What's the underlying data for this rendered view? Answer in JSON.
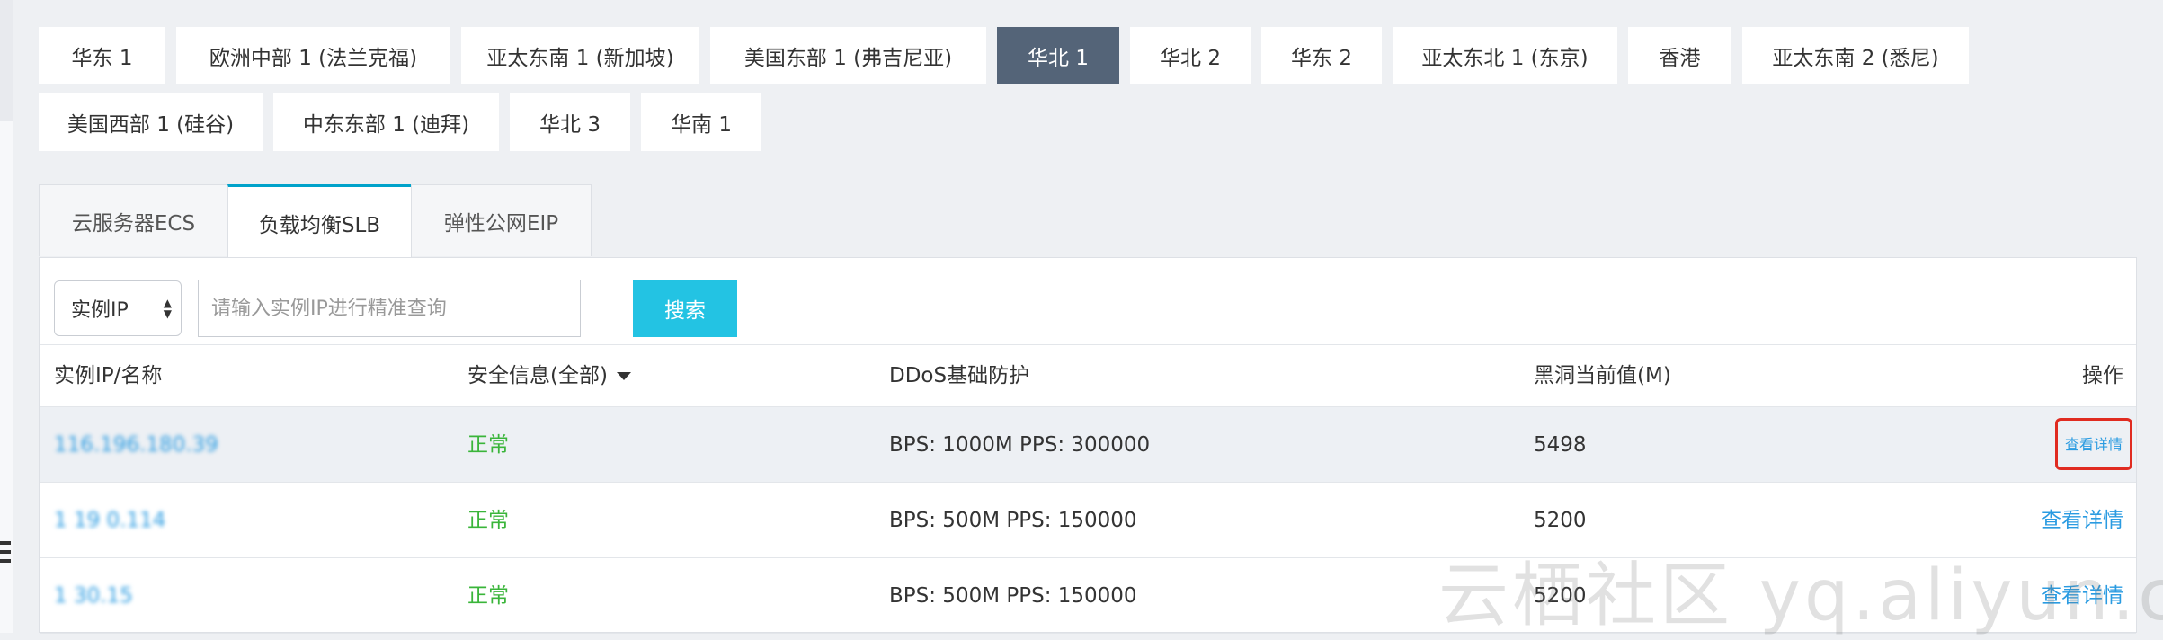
{
  "regions": {
    "row1": [
      "华东 1",
      "欧洲中部 1 (法兰克福)",
      "亚太东南 1 (新加坡)",
      "美国东部 1 (弗吉尼亚)",
      "华北 1",
      "华北 2",
      "华东 2",
      "亚太东北 1 (东京)",
      "香港",
      "亚太东南 2 (悉尼)"
    ],
    "row2": [
      "美国西部 1 (硅谷)",
      "中东东部 1 (迪拜)",
      "华北 3",
      "华南 1"
    ],
    "active": "华北 1"
  },
  "service_tabs": [
    "云服务器ECS",
    "负载均衡SLB",
    "弹性公网EIP"
  ],
  "active_service_tab": "负载均衡SLB",
  "filter": {
    "select_value": "实例IP",
    "search_placeholder": "请输入实例IP进行精准查询",
    "search_button": "搜索"
  },
  "table": {
    "headers": {
      "ip": "实例IP/名称",
      "security": "安全信息(全部)",
      "ddos": "DDoS基础防护",
      "blackhole": "黑洞当前值(M)",
      "action": "操作"
    },
    "rows": [
      {
        "ip": "116.196.180.39",
        "security": "正常",
        "ddos": "BPS: 1000M  PPS: 300000",
        "blackhole": "5498",
        "action": "查看详情"
      },
      {
        "ip": "1  19   0.114",
        "security": "正常",
        "ddos": "BPS: 500M  PPS: 150000",
        "blackhole": "5200",
        "action": "查看详情"
      },
      {
        "ip": "1      30.15",
        "security": "正常",
        "ddos": "BPS: 500M  PPS: 150000",
        "blackhole": "5200",
        "action": "查看详情"
      }
    ]
  },
  "watermark": "云栖社区 yq.aliyun.com",
  "colors": {
    "active_region": "#546478",
    "search_button": "#23c3e3",
    "link": "#2a9be1",
    "status_ok": "#3ab53a",
    "highlight_box": "#e02b20"
  }
}
